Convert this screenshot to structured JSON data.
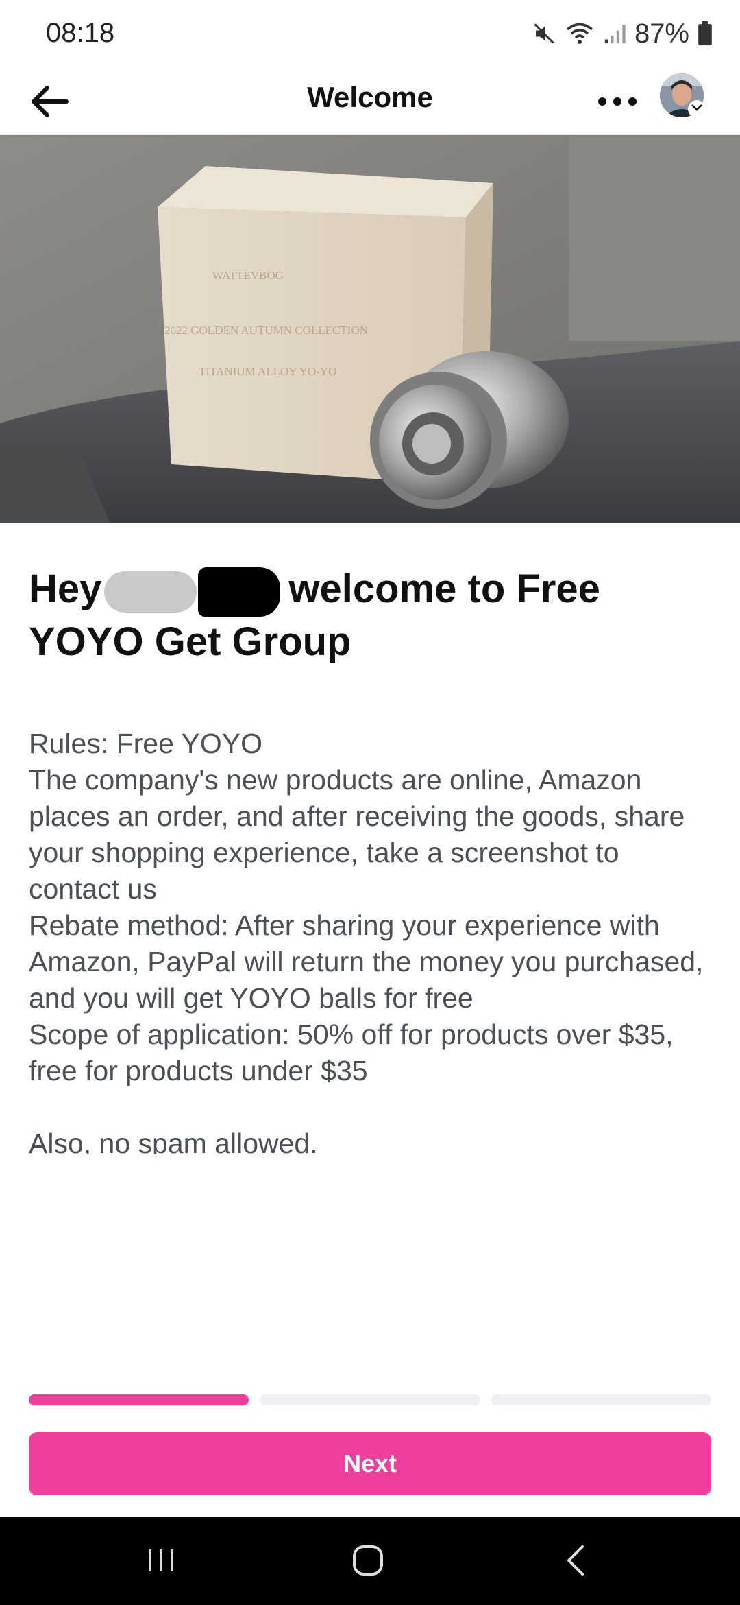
{
  "status_bar": {
    "time": "08:18",
    "battery": "87%",
    "icons": [
      "mute-icon",
      "wifi-icon",
      "signal-icon",
      "battery-icon"
    ]
  },
  "header": {
    "title": "Welcome",
    "back_icon": "arrow-left-icon",
    "more_icon": "more-horizontal-icon"
  },
  "hero": {
    "box_text": [
      "WATTEVBOG",
      "2022 GOLDEN AUTUMN COLLECTION",
      "TITANIUM ALLOY YO-YO"
    ]
  },
  "welcome": {
    "greeting": "Hey",
    "headline_rest": "welcome to Free YOYO Get Group"
  },
  "rules": {
    "lines": [
      "Rules: Free YOYO",
      "The company's new products are online, Amazon places an order, and after receiving the goods, share your shopping experience, take a screenshot to contact us",
      "Rebate method: After sharing your experience with Amazon, PayPal will return the money you purchased, and you will get YOYO balls for free",
      "Scope of application: 50% off for products over $35, free for products under $35"
    ],
    "footer": "Also, no spam allowed."
  },
  "progress": {
    "current_step": 1,
    "total_steps": 3
  },
  "next_label": "Next",
  "colors": {
    "accent": "#ee3f9c",
    "nav_bg": "#000000"
  }
}
